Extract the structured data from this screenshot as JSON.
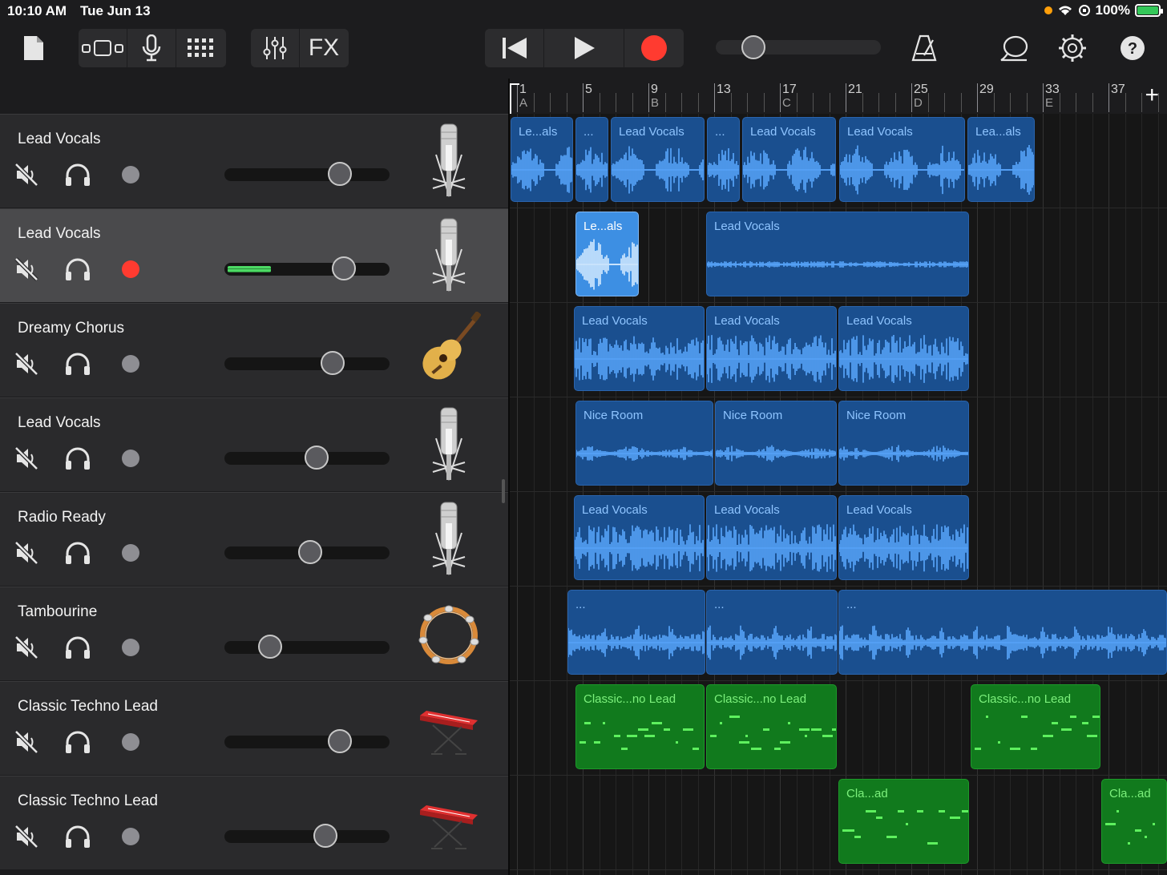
{
  "status": {
    "time": "10:10 AM",
    "date": "Tue Jun 13",
    "battery": "100%"
  },
  "toolbar": {
    "fx_label": "FX"
  },
  "ruler": {
    "bars": [
      "1",
      "5",
      "9",
      "13",
      "17",
      "21",
      "25",
      "29",
      "33",
      "37"
    ],
    "markers": [
      "A",
      "B",
      "C",
      "D",
      "E"
    ],
    "add_label": "+"
  },
  "tracks": [
    {
      "name": "Lead Vocals",
      "instrument": "microphone-icon",
      "armed": false,
      "selected": false,
      "volume": 0.71,
      "regions": [
        {
          "label": "Le...als",
          "type": "audio"
        },
        {
          "label": "...",
          "type": "audio"
        },
        {
          "label": "Lead Vocals",
          "type": "audio"
        },
        {
          "label": "...",
          "type": "audio"
        },
        {
          "label": "Lead Vocals",
          "type": "audio"
        },
        {
          "label": "Lead Vocals",
          "type": "audio"
        },
        {
          "label": "Lea...als",
          "type": "audio"
        }
      ]
    },
    {
      "name": "Lead Vocals",
      "instrument": "microphone-icon",
      "armed": true,
      "selected": true,
      "volume": 0.74,
      "regions": [
        {
          "label": "Le...als",
          "type": "audio",
          "selected": true
        },
        {
          "label": "Lead Vocals",
          "type": "audio"
        }
      ]
    },
    {
      "name": "Dreamy Chorus",
      "instrument": "acoustic-guitar-icon",
      "armed": false,
      "selected": false,
      "volume": 0.66,
      "regions": [
        {
          "label": "Lead Vocals",
          "type": "audio"
        },
        {
          "label": "Lead Vocals",
          "type": "audio"
        },
        {
          "label": "Lead Vocals",
          "type": "audio"
        }
      ]
    },
    {
      "name": "Lead Vocals",
      "instrument": "microphone-icon",
      "armed": false,
      "selected": false,
      "volume": 0.55,
      "regions": [
        {
          "label": "Nice Room",
          "type": "audio"
        },
        {
          "label": "Nice Room",
          "type": "audio"
        },
        {
          "label": "Nice Room",
          "type": "audio"
        }
      ]
    },
    {
      "name": "Radio Ready",
      "instrument": "microphone-icon",
      "armed": false,
      "selected": false,
      "volume": 0.5,
      "regions": [
        {
          "label": "Lead Vocals",
          "type": "audio"
        },
        {
          "label": "Lead Vocals",
          "type": "audio"
        },
        {
          "label": "Lead Vocals",
          "type": "audio"
        }
      ]
    },
    {
      "name": "Tambourine",
      "instrument": "tambourine-icon",
      "armed": false,
      "selected": false,
      "volume": 0.22,
      "regions": [
        {
          "label": "...",
          "type": "audio"
        },
        {
          "label": "...",
          "type": "audio"
        },
        {
          "label": "...",
          "type": "audio"
        }
      ]
    },
    {
      "name": "Classic Techno Lead",
      "instrument": "synth-keyboard-icon",
      "armed": false,
      "selected": false,
      "volume": 0.71,
      "regions": [
        {
          "label": "Classic...no Lead",
          "type": "midi"
        },
        {
          "label": "Classic...no Lead",
          "type": "midi"
        },
        {
          "label": "Classic...no Lead",
          "type": "midi"
        }
      ]
    },
    {
      "name": "Classic Techno Lead",
      "instrument": "synth-keyboard-icon",
      "armed": false,
      "selected": false,
      "volume": 0.61,
      "regions": [
        {
          "label": "Cla...ad",
          "type": "midi"
        },
        {
          "label": "Cla...ad",
          "type": "midi"
        }
      ]
    }
  ]
}
